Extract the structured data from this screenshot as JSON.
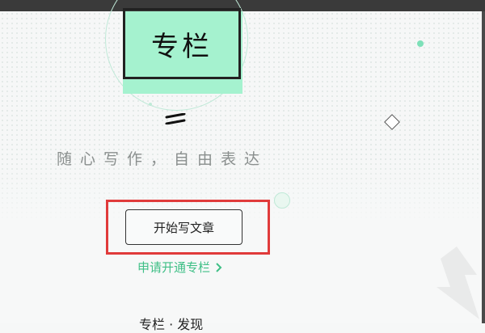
{
  "logo": {
    "text": "专栏"
  },
  "tagline": "随心写作，自由表达",
  "primary_action": {
    "label": "开始写文章"
  },
  "secondary_action": {
    "label": "申请开通专栏"
  },
  "section_heading": "专栏 · 发现",
  "colors": {
    "accent_mint": "#a5f2cf",
    "link_green": "#3fbf86",
    "highlight_red": "#e03b3b"
  },
  "icons": [
    "equals-icon",
    "diamond-icon",
    "chevron-right-icon"
  ]
}
